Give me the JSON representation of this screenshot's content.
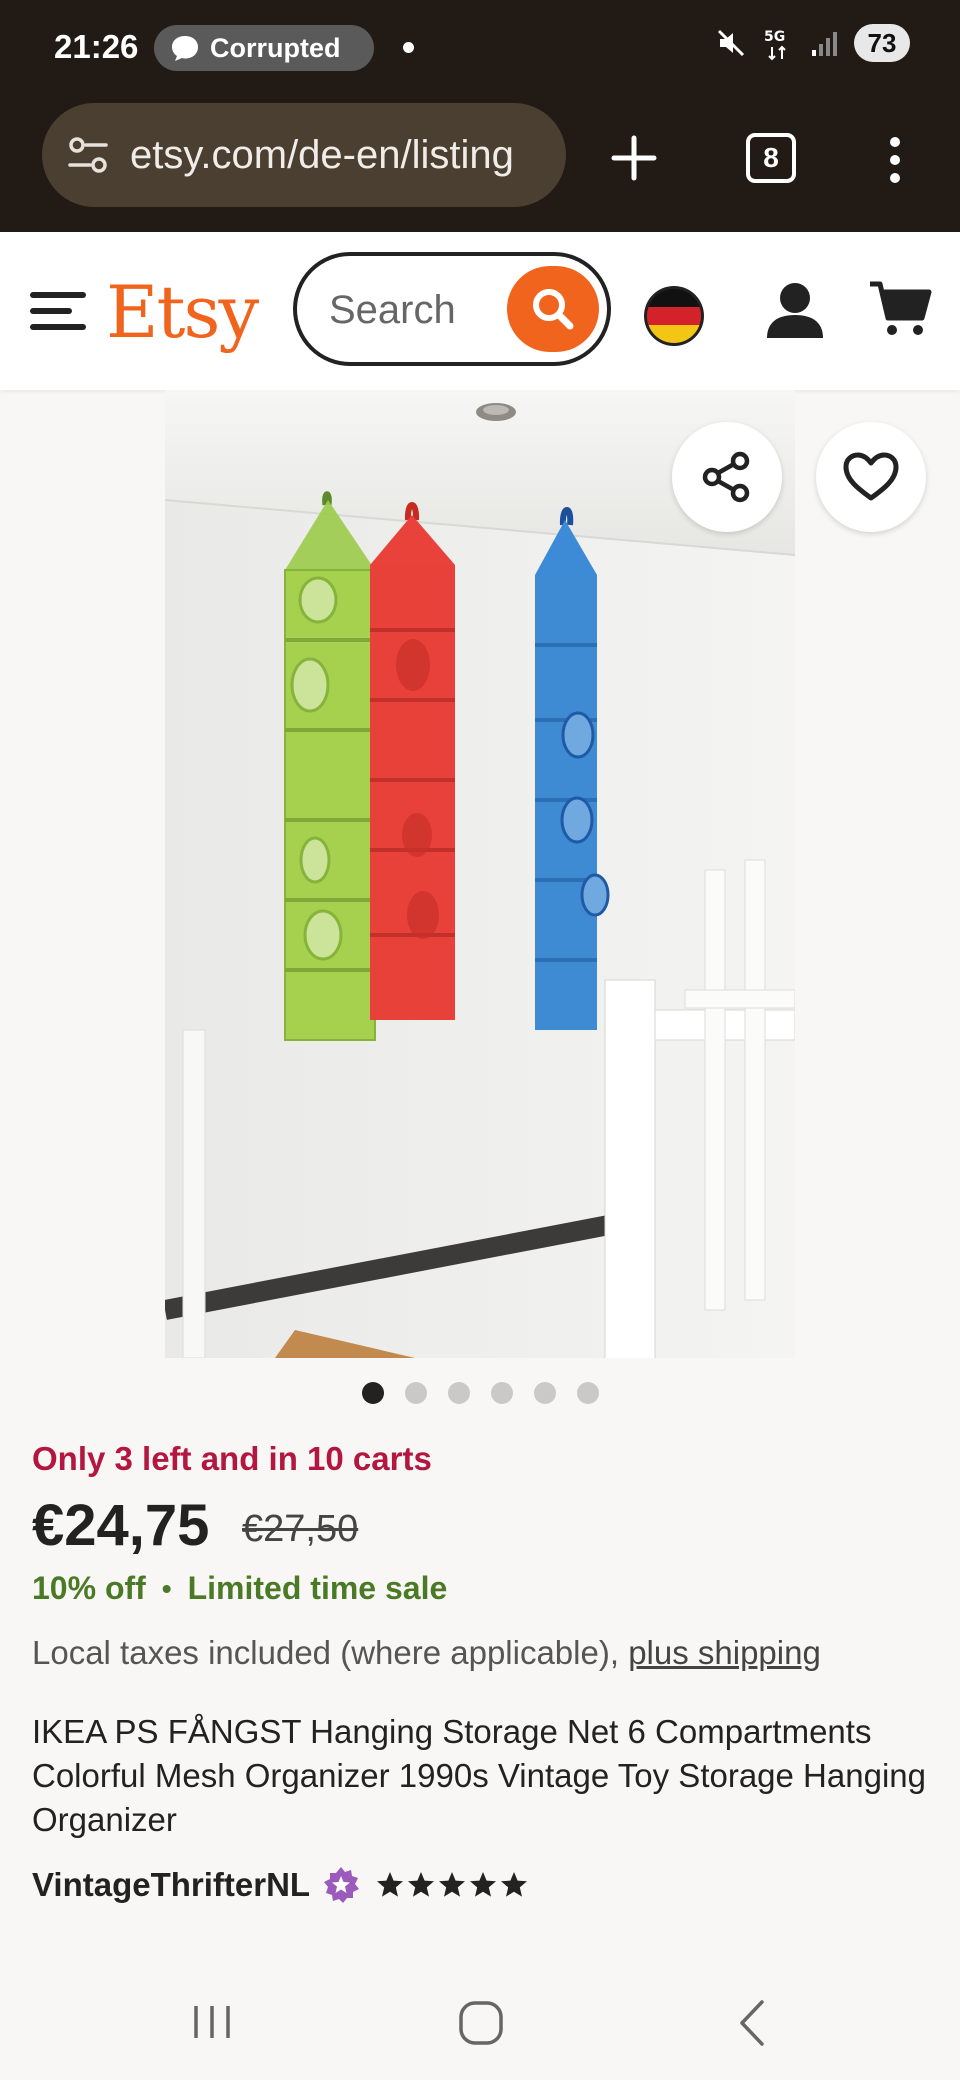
{
  "status_bar": {
    "time": "21:26",
    "notification_label": "Corrupted",
    "network": "5G",
    "battery": "73"
  },
  "browser": {
    "url": "etsy.com/de-en/listing",
    "tab_count": "8"
  },
  "header": {
    "logo": "Etsy",
    "search_placeholder": "Search",
    "brand_color": "#f1641e"
  },
  "gallery": {
    "image_count": 6,
    "active_index": 0
  },
  "product": {
    "stock_notice": "Only 3 left and in 10 carts",
    "price": "€24,75",
    "original_price": "€27,50",
    "discount": "10% off",
    "sale_label": "Limited time sale",
    "tax_text": "Local taxes included (where applicable),",
    "shipping_link": "plus shipping",
    "title": "IKEA PS FÅNGST Hanging Storage Net 6 Compartments Colorful Mesh Organizer 1990s Vintage Toy Storage Hanging Organizer",
    "shop_name": "VintageThrifterNL",
    "rating": 5
  },
  "icons": [
    "message-icon",
    "mute-icon",
    "signal-icon",
    "tune-icon",
    "plus-icon",
    "tabs-icon",
    "menu-icon",
    "hamburger-icon",
    "search-icon",
    "germany-flag-icon",
    "user-icon",
    "cart-icon",
    "share-icon",
    "heart-icon",
    "star-seller-icon",
    "star-icon"
  ]
}
